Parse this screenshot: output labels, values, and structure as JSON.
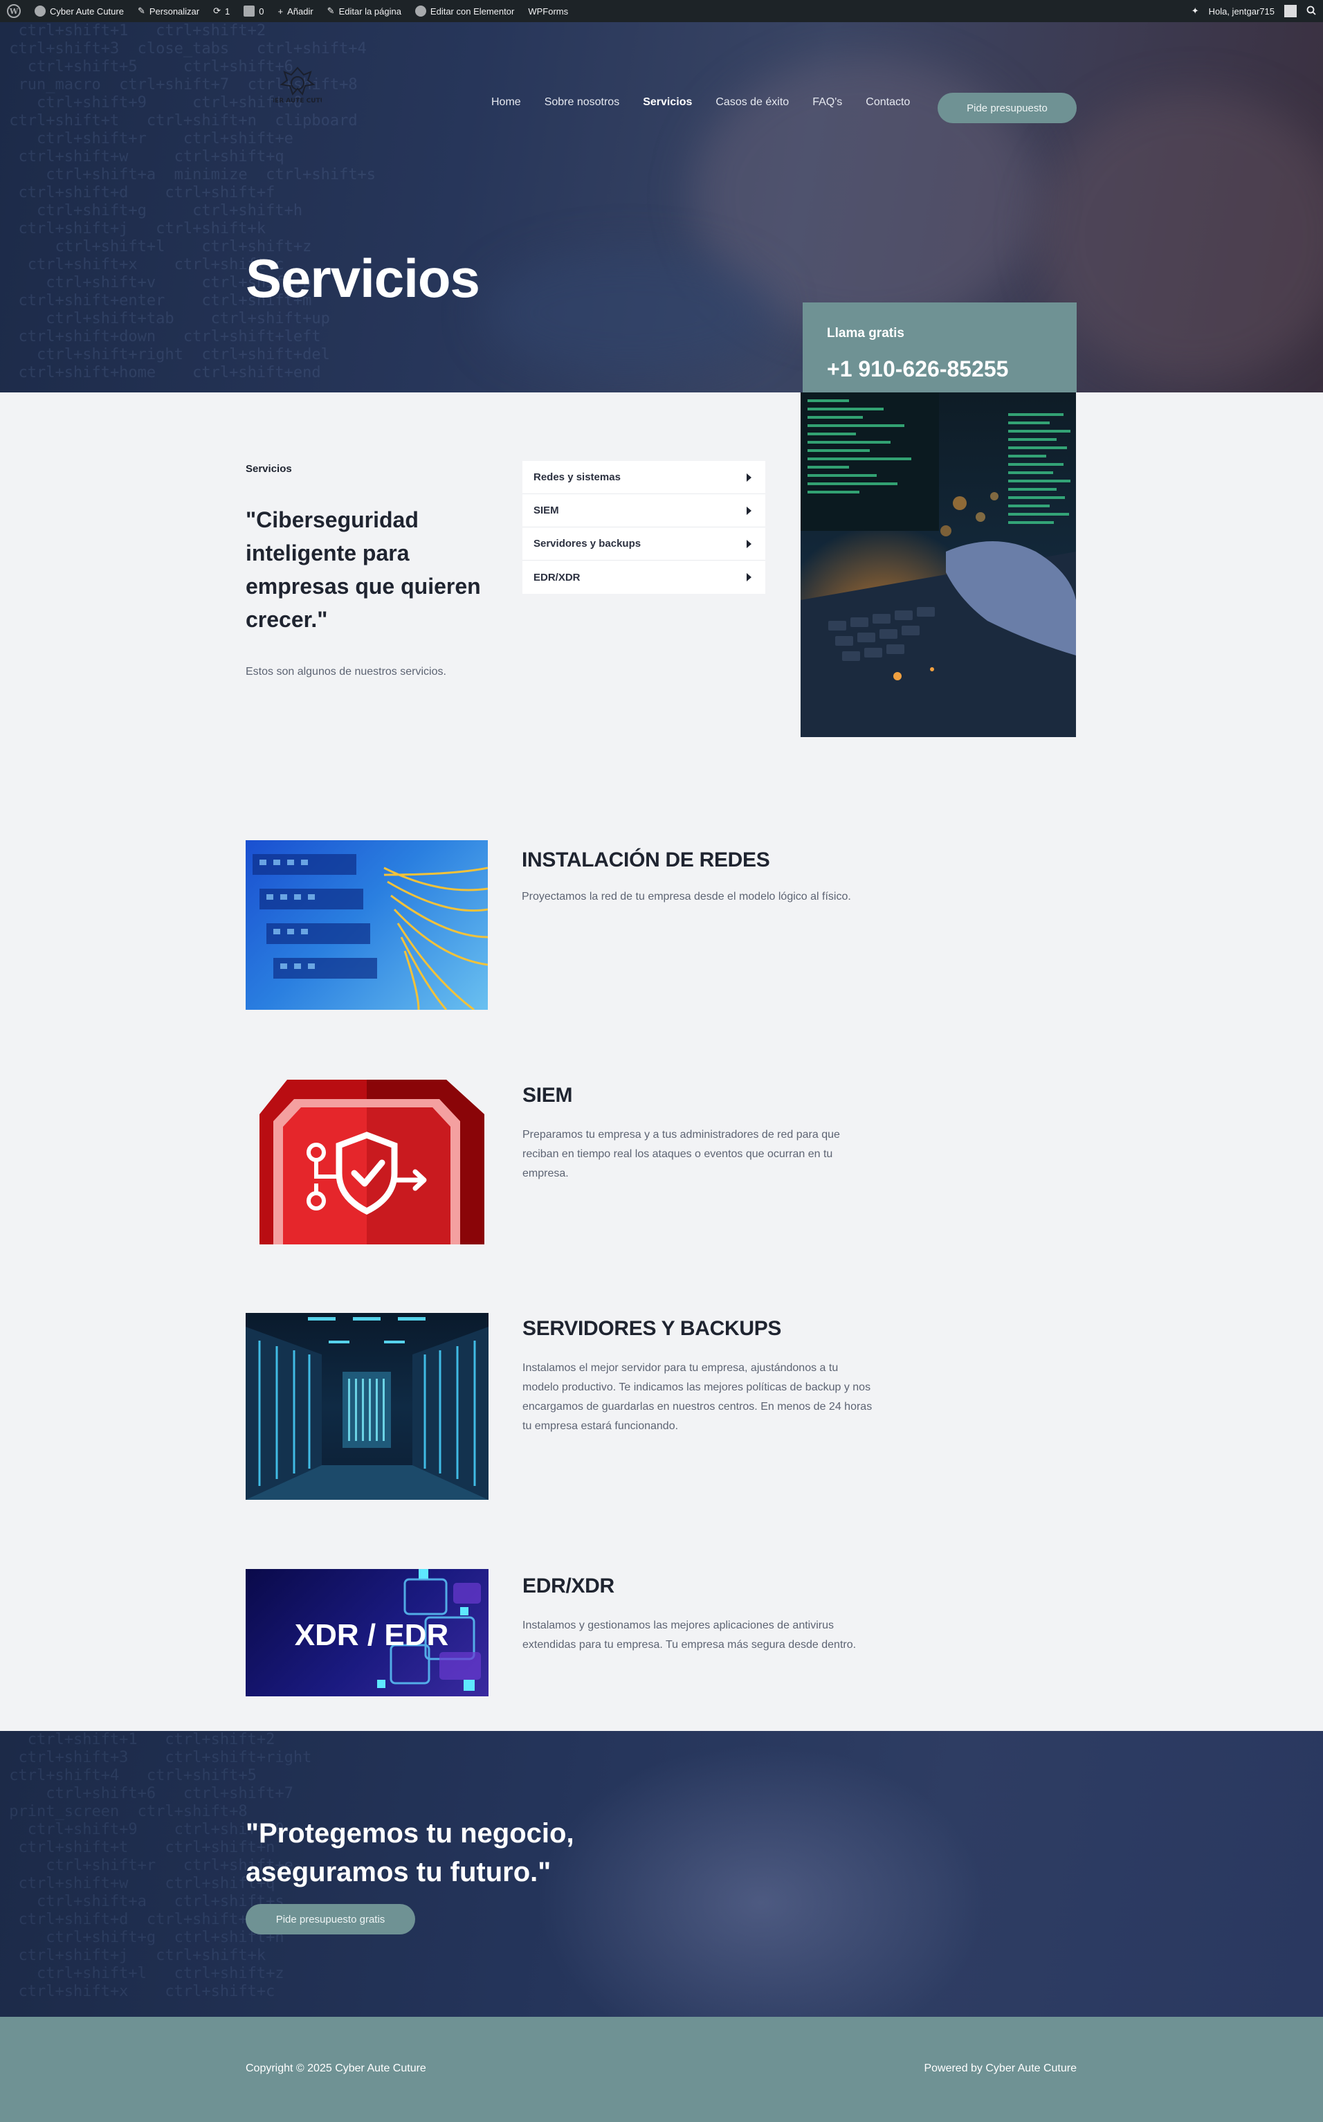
{
  "adminbar": {
    "site": "Cyber Aute Cuture",
    "customize": "Personalizar",
    "updates": "1",
    "comments": "0",
    "new": "Añadir",
    "edit_page": "Editar la página",
    "elementor": "Editar con Elementor",
    "wpforms": "WPForms",
    "greeting": "Hola, jentgar715"
  },
  "header": {
    "logo_alt": "CYBER AUTE CUTURE",
    "menu": [
      "Home",
      "Sobre nosotros",
      "Servicios",
      "Casos de éxito",
      "FAQ's",
      "Contacto"
    ],
    "active_menu": "Servicios",
    "cta_label": "Pide presupuesto"
  },
  "hero": {
    "title": "Servicios",
    "call_label": "Llama gratis",
    "call_number": "+1 910-626-85255"
  },
  "intro": {
    "kicker": "Servicios",
    "quote": "\"Ciberseguridad inteligente para empresas que quieren crecer.\"",
    "subtitle": "Estos son algunos de nuestros servicios.",
    "menu": [
      "Redes y sistemas",
      "SIEM",
      "Servidores y backups",
      "EDR/XDR"
    ]
  },
  "services": [
    {
      "title": "INSTALACIÓN DE REDES",
      "desc": "Proyectamos la red de tu empresa desde el modelo lógico al físico."
    },
    {
      "title": "SIEM",
      "desc": "Preparamos tu empresa y a tus administradores de red para que reciban en tiempo real los ataques o eventos que ocurran en tu empresa."
    },
    {
      "title": "SERVIDORES Y BACKUPS",
      "desc": "Instalamos el mejor servidor para tu empresa, ajustándonos a tu modelo productivo. Te indicamos las mejores políticas de backup y nos encargamos de guardarlas en nuestros centros. En menos de 24 horas tu empresa estará funcionando."
    },
    {
      "title": "EDR/XDR",
      "desc": "Instalamos y gestionamos las mejores aplicaciones de antivirus extendidas para tu empresa. Tu empresa más segura desde dentro.",
      "image_text": "XDR / EDR"
    }
  ],
  "cta": {
    "quote": "\"Protegemos tu negocio, aseguramos tu futuro.\"",
    "button": "Pide presupuesto gratis"
  },
  "footer": {
    "copyright": "Copyright © 2025 Cyber Aute Cuture",
    "powered": "Powered by Cyber Aute Cuture"
  },
  "colors": {
    "accent": "#6f9294",
    "dark_text": "#1f2430",
    "muted_text": "#5d6473",
    "admin_bar": "#1d2327",
    "page_bg": "#f2f3f5"
  }
}
